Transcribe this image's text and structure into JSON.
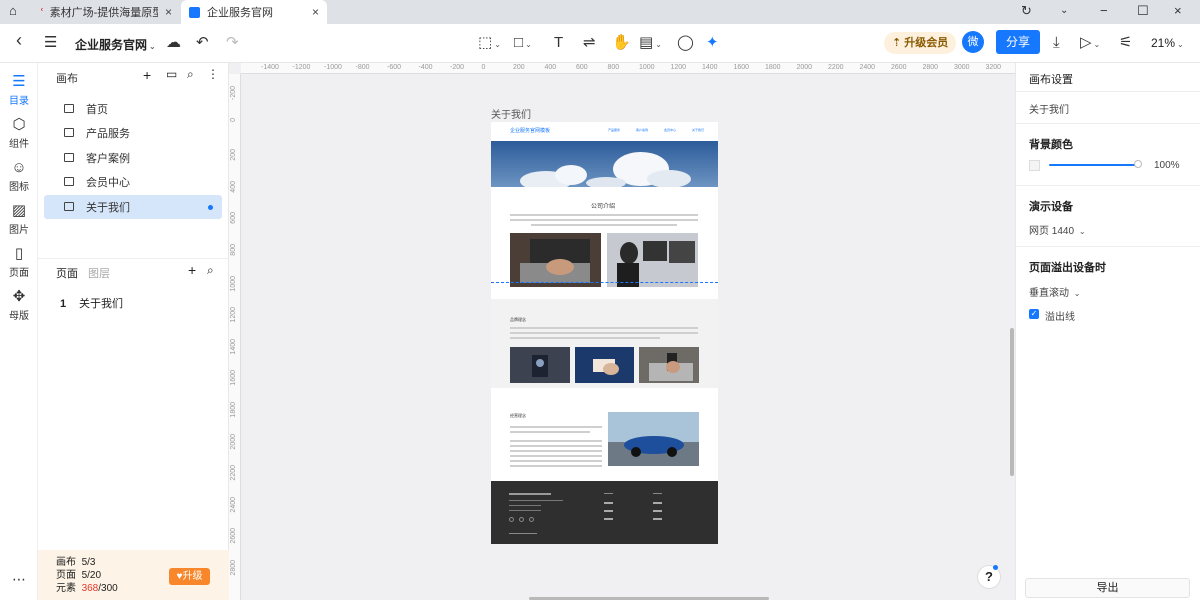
{
  "browser": {
    "tabs": [
      {
        "label": "素材广场-提供海量原型模"
      },
      {
        "label": "企业服务官网"
      }
    ]
  },
  "toolbar": {
    "project_name": "企业服务官网",
    "upgrade_label": "升级会员",
    "wechat_label": "微",
    "share_label": "分享",
    "zoom": "21%"
  },
  "leftrail": {
    "items": [
      {
        "label": "目录"
      },
      {
        "label": "组件"
      },
      {
        "label": "图标"
      },
      {
        "label": "图片"
      },
      {
        "label": "页面"
      },
      {
        "label": "母版"
      }
    ]
  },
  "canvas_panel": {
    "title": "画布",
    "items": [
      {
        "label": "首页"
      },
      {
        "label": "产品服务"
      },
      {
        "label": "客户案例"
      },
      {
        "label": "会员中心"
      },
      {
        "label": "关于我们"
      }
    ]
  },
  "pages_panel": {
    "tab_pages": "页面",
    "tab_layers": "图层",
    "items": [
      {
        "number": "1",
        "label": "关于我们"
      }
    ]
  },
  "quota": {
    "canvas_label": "画布",
    "canvas_value": "5/3",
    "pages_label": "页面",
    "pages_value": "5/20",
    "elements_label": "元素",
    "elements_used": "368",
    "elements_total": "/300",
    "upgrade_label": "升级"
  },
  "ruler": {
    "h": [
      "-1400",
      "-1200",
      "-1000",
      "-800",
      "-600",
      "-400",
      "-200",
      "0",
      "200",
      "400",
      "600",
      "800",
      "1000",
      "1200",
      "1400",
      "1600",
      "1800",
      "2000",
      "2200",
      "2400",
      "2600",
      "2800",
      "3000",
      "3200"
    ],
    "v": [
      "-200",
      "0",
      "200",
      "400",
      "600",
      "800",
      "1000",
      "1200",
      "1400",
      "1600",
      "1800",
      "2000",
      "2200",
      "2400",
      "2600",
      "2800"
    ]
  },
  "artboard": {
    "title": "关于我们",
    "site_logo": "企业服务官网模板",
    "nav": [
      "产品服务",
      "客户案例",
      "会员中心",
      "关于我们"
    ],
    "section1_title": "公司介绍",
    "section2_title": "品牌理念",
    "section3_title": "经营理念"
  },
  "right": {
    "canvas_settings": "画布设置",
    "page_name": "关于我们",
    "bg_title": "背景颜色",
    "bg_percent": "100%",
    "device_title": "演示设备",
    "device_value": "网页 1440",
    "overflow_title": "页面溢出设备时",
    "overflow_value": "垂直滚动",
    "overflow_line": "溢出线",
    "export_label": "导出"
  },
  "colors": {
    "accent": "#1677ff",
    "footer": "#2f2f2f"
  }
}
